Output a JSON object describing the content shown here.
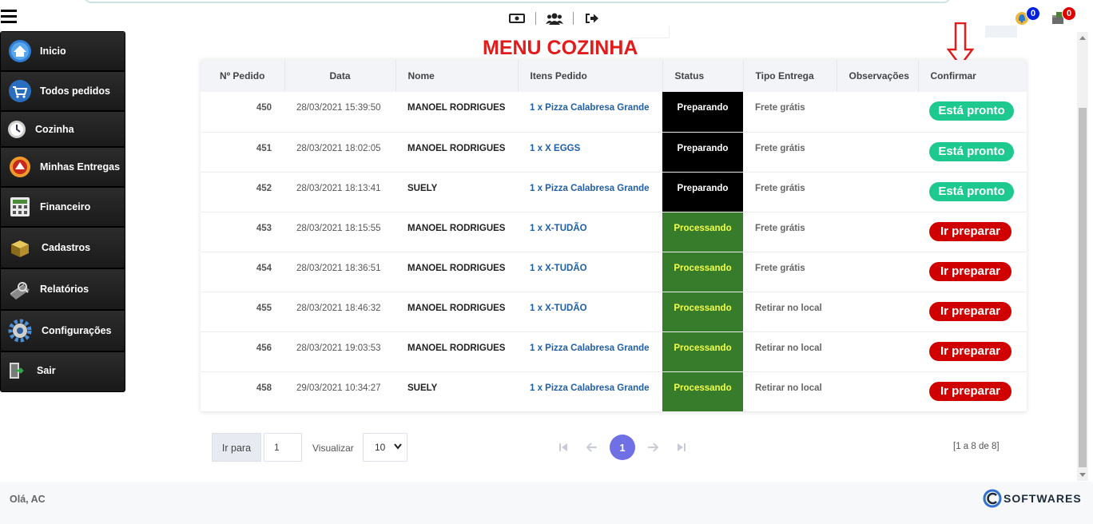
{
  "header": {
    "notifications_count": "0",
    "orders_count": "0"
  },
  "sidebar": {
    "items": [
      {
        "label": "Inicio",
        "icon": "home-icon"
      },
      {
        "label": "Todos pedidos",
        "icon": "cart-icon"
      },
      {
        "label": "Cozinha",
        "icon": "clock-icon"
      },
      {
        "label": "Minhas Entregas",
        "icon": "delivery-icon"
      },
      {
        "label": "Financeiro",
        "icon": "calculator-icon"
      },
      {
        "label": "Cadastros",
        "icon": "box-icon"
      },
      {
        "label": "Relatórios",
        "icon": "report-icon"
      },
      {
        "label": "Configurações",
        "icon": "gear-icon"
      },
      {
        "label": "Sair",
        "icon": "exit-icon"
      }
    ]
  },
  "page_title": "MENU COZINHA",
  "table": {
    "headers": [
      "Nº Pedido",
      "Data",
      "Nome",
      "Itens Pedido",
      "Status",
      "Tipo Entrega",
      "Observações",
      "Confirmar"
    ],
    "rows": [
      {
        "num": "450",
        "data": "28/03/2021 15:39:50",
        "nome": "MANOEL RODRIGUES",
        "itens": "1 x Pizza Calabresa Grande",
        "status": "Preparando",
        "tipo": "Frete grátis",
        "obs": "",
        "action": "Está pronto"
      },
      {
        "num": "451",
        "data": "28/03/2021 18:02:05",
        "nome": "MANOEL RODRIGUES",
        "itens": "1 x X EGGS",
        "status": "Preparando",
        "tipo": "Frete grátis",
        "obs": "",
        "action": "Está pronto"
      },
      {
        "num": "452",
        "data": "28/03/2021 18:13:41",
        "nome": "SUELY",
        "itens": "1 x Pizza Calabresa Grande",
        "status": "Preparando",
        "tipo": "Frete grátis",
        "obs": "",
        "action": "Está pronto"
      },
      {
        "num": "453",
        "data": "28/03/2021 18:15:55",
        "nome": "MANOEL RODRIGUES",
        "itens": "1 x X-TUDÃO",
        "status": "Processando",
        "tipo": "Frete grátis",
        "obs": "",
        "action": "Ir preparar"
      },
      {
        "num": "454",
        "data": "28/03/2021 18:36:51",
        "nome": "MANOEL RODRIGUES",
        "itens": "1 x X-TUDÃO",
        "status": "Processando",
        "tipo": "Frete grátis",
        "obs": "",
        "action": "Ir preparar"
      },
      {
        "num": "455",
        "data": "28/03/2021 18:46:32",
        "nome": "MANOEL RODRIGUES",
        "itens": "1 x X-TUDÃO",
        "status": "Processando",
        "tipo": "Retirar no local",
        "obs": "",
        "action": "Ir preparar"
      },
      {
        "num": "456",
        "data": "28/03/2021 19:03:53",
        "nome": "MANOEL RODRIGUES",
        "itens": "1 x Pizza Calabresa Grande",
        "status": "Processando",
        "tipo": "Retirar no local",
        "obs": "",
        "action": "Ir preparar"
      },
      {
        "num": "458",
        "data": "29/03/2021 10:34:27",
        "nome": "SUELY",
        "itens": "1 x Pizza Calabresa Grande",
        "status": "Processando",
        "tipo": "Retirar no local",
        "obs": "",
        "action": "Ir preparar"
      }
    ]
  },
  "pagination": {
    "goto_label": "Ir para",
    "page_input_value": "1",
    "view_label": "Visualizar",
    "page_size": "10",
    "current_page": "1",
    "range_text": "[1 a 8 de 8]"
  },
  "footer": {
    "greeting": "Olá, AC",
    "brand": "SOFTWARES"
  },
  "colors": {
    "title_red": "#e21b1b",
    "status_preparando_bg": "#000000",
    "status_processando_bg": "#367c2b",
    "btn_pronto": "#1ec98f",
    "btn_preparar": "#d10000",
    "pager_current": "#6f6fe6"
  }
}
